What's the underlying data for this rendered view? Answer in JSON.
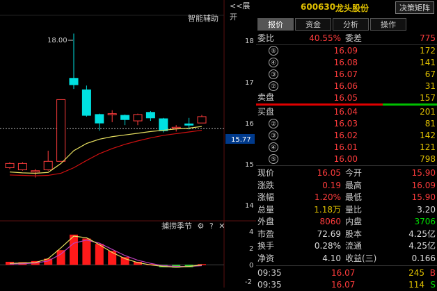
{
  "chart_header": {
    "collapse_label": "<<展开",
    "assist_label": "智能辅助",
    "max_label": "18.00"
  },
  "price_axis": {
    "ticks": [
      "18",
      "17",
      "16",
      "15",
      "14"
    ],
    "current": "15.77"
  },
  "indicator": {
    "name": "捕捞季节",
    "gear_icon": "gear-icon",
    "help": "?",
    "close": "✕",
    "ticks": [
      "4",
      "2",
      "0",
      "-2"
    ]
  },
  "header": {
    "code": "600630",
    "name": "龙头股份",
    "matrix_button": "决策矩阵"
  },
  "tabs": [
    "报价",
    "资金",
    "分析",
    "操作"
  ],
  "weibi": {
    "label": "委比",
    "ratio": "40.55%",
    "diff_label": "委差",
    "diff": "775"
  },
  "sell_label": "卖盘",
  "buy_label": "买盘",
  "sell": [
    {
      "n": "⑤",
      "price": "16.09",
      "vol": "172"
    },
    {
      "n": "④",
      "price": "16.08",
      "vol": "141"
    },
    {
      "n": "③",
      "price": "16.07",
      "vol": "67"
    },
    {
      "n": "②",
      "price": "16.06",
      "vol": "31"
    },
    {
      "n": "①",
      "price": "16.05",
      "vol": "157"
    }
  ],
  "buy": [
    {
      "n": "①",
      "price": "16.04",
      "vol": "201"
    },
    {
      "n": "②",
      "price": "16.03",
      "vol": "81"
    },
    {
      "n": "③",
      "price": "16.02",
      "vol": "142"
    },
    {
      "n": "④",
      "price": "16.01",
      "vol": "121"
    },
    {
      "n": "⑤",
      "price": "16.00",
      "vol": "798"
    }
  ],
  "quote": [
    {
      "l1": "现价",
      "v1": "16.05",
      "c1": "red",
      "l2": "今开",
      "v2": "15.90",
      "c2": "red"
    },
    {
      "l1": "涨跌",
      "v1": "0.19",
      "c1": "red",
      "l2": "最高",
      "v2": "16.09",
      "c2": "red"
    },
    {
      "l1": "涨幅",
      "v1": "1.20%",
      "c1": "red",
      "l2": "最低",
      "v2": "15.90",
      "c2": "red"
    },
    {
      "l1": "总量",
      "v1": "1.18万",
      "c1": "yel",
      "l2": "量比",
      "v2": "3.20",
      "c2": "wht"
    },
    {
      "l1": "外盘",
      "v1": "8060",
      "c1": "red",
      "l2": "内盘",
      "v2": "3706",
      "c2": "grn"
    },
    {
      "l1": "市盈",
      "v1": "72.69",
      "c1": "wht",
      "l2": "股本",
      "v2": "4.25亿",
      "c2": "wht"
    },
    {
      "l1": "换手",
      "v1": "0.28%",
      "c1": "wht",
      "l2": "流通",
      "v2": "4.25亿",
      "c2": "wht"
    },
    {
      "l1": "净资",
      "v1": "4.10",
      "c1": "wht",
      "l2": "收益(三)",
      "v2": "0.166",
      "c2": "wht"
    }
  ],
  "ticks": [
    {
      "time": "09:35",
      "price": "16.07",
      "vol": "245",
      "side": "B"
    },
    {
      "time": "09:35",
      "price": "16.07",
      "vol": "114",
      "side": "S"
    }
  ],
  "chart_data": {
    "type": "candlestick",
    "ylim": [
      13.7,
      18.3
    ],
    "max_marker": 18.0,
    "current_price": 15.77,
    "candles": [
      {
        "o": 14.85,
        "c": 14.95,
        "h": 14.98,
        "l": 14.82
      },
      {
        "o": 14.8,
        "c": 14.95,
        "h": 14.98,
        "l": 14.78
      },
      {
        "o": 14.75,
        "c": 14.78,
        "h": 14.82,
        "l": 14.62
      },
      {
        "o": 14.8,
        "c": 15.0,
        "h": 15.25,
        "l": 14.78
      },
      {
        "o": 15.0,
        "c": 16.45,
        "h": 16.45,
        "l": 15.0
      },
      {
        "o": 16.95,
        "c": 16.8,
        "h": 18.0,
        "l": 16.7
      },
      {
        "o": 16.68,
        "c": 16.08,
        "h": 16.78,
        "l": 16.05
      },
      {
        "o": 16.1,
        "c": 15.9,
        "h": 16.12,
        "l": 15.72
      },
      {
        "o": 16.1,
        "c": 16.12,
        "h": 16.2,
        "l": 15.92
      },
      {
        "o": 16.08,
        "c": 15.98,
        "h": 16.1,
        "l": 15.85
      },
      {
        "o": 15.95,
        "c": 16.1,
        "h": 16.12,
        "l": 15.85
      },
      {
        "o": 16.15,
        "c": 16.02,
        "h": 16.18,
        "l": 15.95
      },
      {
        "o": 16.0,
        "c": 15.72,
        "h": 16.02,
        "l": 15.68
      },
      {
        "o": 15.78,
        "c": 15.8,
        "h": 15.85,
        "l": 15.7
      },
      {
        "o": 15.88,
        "c": 15.85,
        "h": 16.02,
        "l": 15.75
      },
      {
        "o": 15.9,
        "c": 16.05,
        "h": 16.09,
        "l": 15.9
      }
    ],
    "ma_short": [
      14.75,
      14.73,
      14.72,
      14.74,
      14.95,
      15.25,
      15.42,
      15.52,
      15.58,
      15.62,
      15.66,
      15.7,
      15.73,
      15.76,
      15.78,
      15.82
    ],
    "ma_long": [
      14.68,
      14.67,
      14.66,
      14.67,
      14.72,
      14.85,
      15.02,
      15.18,
      15.3,
      15.4,
      15.48,
      15.55,
      15.61,
      15.65,
      15.69,
      15.73
    ],
    "indicator": {
      "ylim": [
        -2.2,
        4.6
      ],
      "bars": [
        0.4,
        0.35,
        0.5,
        0.8,
        1.9,
        3.9,
        3.4,
        2.7,
        1.8,
        1.0,
        0.4,
        0.1,
        -0.3,
        -0.35,
        -0.3,
        0.1
      ],
      "line1": [
        0.2,
        0.25,
        0.3,
        0.8,
        2.2,
        3.7,
        3.5,
        2.6,
        1.6,
        0.8,
        0.3,
        0.0,
        -0.2,
        -0.3,
        -0.2,
        0.0
      ],
      "line2": [
        0.1,
        0.15,
        0.25,
        0.5,
        1.4,
        2.8,
        3.2,
        2.8,
        2.0,
        1.2,
        0.6,
        0.2,
        -0.1,
        -0.2,
        -0.2,
        -0.1
      ]
    }
  }
}
